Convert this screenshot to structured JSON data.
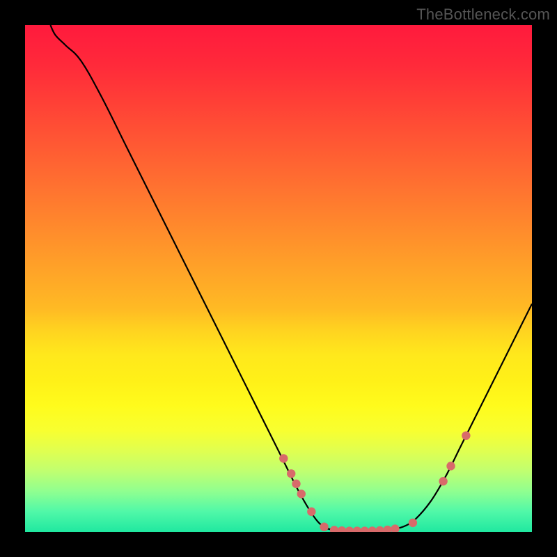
{
  "watermark": "TheBottleneck.com",
  "colors": {
    "curve": "#000000",
    "dot": "#d86a6a",
    "background_top": "#ff1a3d",
    "background_bottom": "#20e8a0"
  },
  "chart_data": {
    "type": "line",
    "title": "",
    "xlabel": "",
    "ylabel": "",
    "xlim": [
      0,
      100
    ],
    "ylim": [
      0,
      100
    ],
    "curve": [
      {
        "x": 5.0,
        "y": 100.0
      },
      {
        "x": 6.0,
        "y": 98.0
      },
      {
        "x": 8.0,
        "y": 96.0
      },
      {
        "x": 11.0,
        "y": 93.0
      },
      {
        "x": 15.0,
        "y": 86.0
      },
      {
        "x": 20.0,
        "y": 76.0
      },
      {
        "x": 25.0,
        "y": 66.0
      },
      {
        "x": 30.0,
        "y": 56.0
      },
      {
        "x": 35.0,
        "y": 46.0
      },
      {
        "x": 40.0,
        "y": 36.0
      },
      {
        "x": 45.0,
        "y": 26.0
      },
      {
        "x": 50.0,
        "y": 16.0
      },
      {
        "x": 54.0,
        "y": 8.0
      },
      {
        "x": 57.0,
        "y": 3.0
      },
      {
        "x": 59.0,
        "y": 1.0
      },
      {
        "x": 61.0,
        "y": 0.4
      },
      {
        "x": 64.0,
        "y": 0.2
      },
      {
        "x": 67.0,
        "y": 0.2
      },
      {
        "x": 70.0,
        "y": 0.3
      },
      {
        "x": 73.0,
        "y": 0.6
      },
      {
        "x": 75.0,
        "y": 1.2
      },
      {
        "x": 77.0,
        "y": 2.5
      },
      {
        "x": 80.0,
        "y": 6.0
      },
      {
        "x": 83.0,
        "y": 11.0
      },
      {
        "x": 86.0,
        "y": 17.0
      },
      {
        "x": 90.0,
        "y": 25.0
      },
      {
        "x": 95.0,
        "y": 35.0
      },
      {
        "x": 100.0,
        "y": 45.0
      }
    ],
    "dots": [
      {
        "x": 51.0,
        "y": 14.5
      },
      {
        "x": 52.5,
        "y": 11.5
      },
      {
        "x": 53.5,
        "y": 9.5
      },
      {
        "x": 54.5,
        "y": 7.5
      },
      {
        "x": 56.5,
        "y": 4.0
      },
      {
        "x": 59.0,
        "y": 1.0
      },
      {
        "x": 61.0,
        "y": 0.35
      },
      {
        "x": 62.5,
        "y": 0.25
      },
      {
        "x": 64.0,
        "y": 0.2
      },
      {
        "x": 65.5,
        "y": 0.2
      },
      {
        "x": 67.0,
        "y": 0.2
      },
      {
        "x": 68.5,
        "y": 0.22
      },
      {
        "x": 70.0,
        "y": 0.28
      },
      {
        "x": 71.5,
        "y": 0.4
      },
      {
        "x": 73.0,
        "y": 0.6
      },
      {
        "x": 76.5,
        "y": 1.8
      },
      {
        "x": 82.5,
        "y": 10.0
      },
      {
        "x": 84.0,
        "y": 13.0
      },
      {
        "x": 87.0,
        "y": 19.0
      }
    ]
  }
}
